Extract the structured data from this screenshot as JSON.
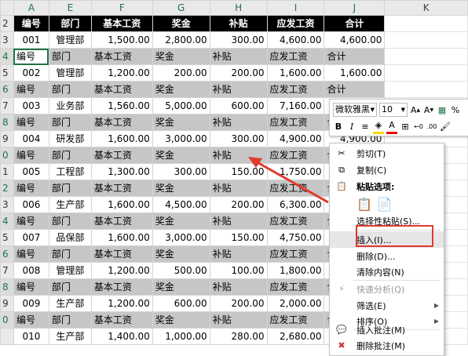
{
  "columns": [
    "A",
    "E",
    "F",
    "G",
    "H",
    "I",
    "J",
    "K"
  ],
  "row_numbers": [
    "2",
    "3",
    "4",
    "5",
    "6",
    "7",
    "8",
    "9",
    "0",
    "1",
    "2",
    "3",
    "4",
    "5",
    "6",
    "7",
    "8",
    "9",
    "0"
  ],
  "header_labels": [
    "编号",
    "部门",
    "基本工资",
    "奖金",
    "补贴",
    "应发工资",
    "合计"
  ],
  "records": [
    [
      "001",
      "管理部",
      "1,500.00",
      "2,800.00",
      "300.00",
      "4,600.00",
      "4,600.00"
    ],
    [
      "002",
      "管理部",
      "1,200.00",
      "200.00",
      "200.00",
      "1,600.00",
      "1,600.00"
    ],
    [
      "003",
      "业务部",
      "1,560.00",
      "5,000.00",
      "600.00",
      "7,160.00",
      ""
    ],
    [
      "004",
      "研发部",
      "1,600.00",
      "3,000.00",
      "300.00",
      "4,900.00",
      "4,900.00"
    ],
    [
      "005",
      "工程部",
      "1,300.00",
      "300.00",
      "150.00",
      "1,750.00",
      ""
    ],
    [
      "006",
      "生产部",
      "1,600.00",
      "4,500.00",
      "200.00",
      "6,300.00",
      ""
    ],
    [
      "007",
      "品保部",
      "1,600.00",
      "3,000.00",
      "150.00",
      "4,750.00",
      ""
    ],
    [
      "008",
      "管理部",
      "1,200.00",
      "500.00",
      "100.00",
      "1,800.00",
      ""
    ],
    [
      "009",
      "生产部",
      "1,200.00",
      "600.00",
      "200.00",
      "2,000.00",
      ""
    ],
    [
      "010",
      "生产部",
      "1,400.00",
      "1,000.00",
      "280.00",
      "2,680.00",
      ""
    ]
  ],
  "mini_toolbar": {
    "font_name": "微软雅黑",
    "font_size": "10",
    "bold": "B",
    "italic": "I",
    "percent": "%",
    "font_color_label": "A"
  },
  "context_menu": {
    "cut": "剪切(T)",
    "copy": "复制(C)",
    "paste_options": "粘贴选项:",
    "paste_special": "选择性粘贴(S)...",
    "insert": "插入(I)...",
    "delete": "删除(D)...",
    "clear": "清除内容(N)",
    "quick_analysis": "快速分析(Q)",
    "filter": "筛选(E)",
    "sort": "排序(O)",
    "insert_comment": "插入批注(M)",
    "delete_comment": "删除批注(M)"
  },
  "colors": {
    "header_bg": "#000000",
    "gray_row_bg": "#c6c6c6",
    "excel_green": "#217346",
    "annotation_red": "#e03a2e"
  }
}
